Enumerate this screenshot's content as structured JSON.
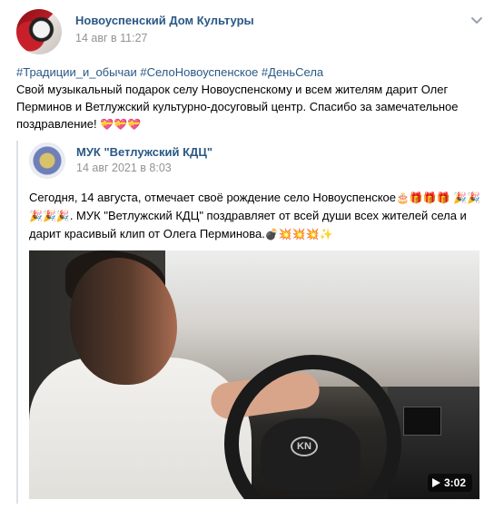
{
  "post": {
    "group_name": "Новоуспенский Дом Культуры",
    "date": "14 авг в 11:27",
    "hashtags": [
      "#Традиции_и_обычаи",
      "#СелоНовоуспенское",
      "#ДеньСела"
    ],
    "text": "Свой музыкальный подарок селу Новоуспенскому и всем жителям дарит Олег Перминов и Ветлужский культурно-досуговый центр. Спасибо за замечательное поздравление!",
    "text_emoji": "💝💝💝"
  },
  "repost": {
    "name": "МУК \"Ветлужский КДЦ\"",
    "date": "14 авг 2021 в 8:03",
    "text_part1": "Сегодня, 14 августа, отмечает своё рождение село Новоуспенское",
    "emoji_1": "🎂🎁🎁🎁",
    "emoji_2": "🎉🎉🎉🎉🎉",
    "text_part2": ". МУК \"Ветлужский КДЦ\" поздравляет от всей души всех жителей села и дарит красивый клип от Олега Перминова.",
    "emoji_3": "💣💥💥💥✨"
  },
  "video": {
    "duration": "3:02",
    "logo_text": "KN"
  },
  "icons": {
    "menu": "chevron-down-icon",
    "play": "play-icon"
  },
  "colors": {
    "link": "#2a5885",
    "muted": "#939393",
    "divider": "#dce1e6"
  }
}
